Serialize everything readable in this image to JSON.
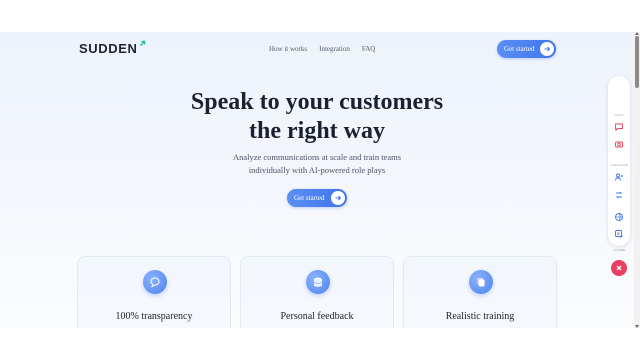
{
  "nav": {
    "logo": "SUDDEN",
    "links": [
      "How it works",
      "Integration",
      "FAQ"
    ],
    "cta_label": "Get started"
  },
  "hero": {
    "title_line1": "Speak to your customers",
    "title_line2": "the right way",
    "subtitle_line1": "Analyze communications at scale and train teams",
    "subtitle_line2": "individually with AI-powered role plays",
    "cta_label": "Get started"
  },
  "features": [
    {
      "title": "100% transparency",
      "icon": "chat-bubble-icon"
    },
    {
      "title": "Personal feedback",
      "icon": "database-icon"
    },
    {
      "title": "Realistic training",
      "icon": "documents-icon"
    }
  ],
  "side_panel": {
    "section1_label": "GOAT",
    "section2_label": "LANGUAGE",
    "section3_label": "AI NAME",
    "icons": [
      "chat-icon",
      "camera-icon",
      "users-icon",
      "translate-icon",
      "globe-icon",
      "edit-icon",
      "close-icon"
    ]
  },
  "colors": {
    "accent": "#4a7ff0",
    "heading": "#1b2130",
    "close": "#e8415f"
  }
}
